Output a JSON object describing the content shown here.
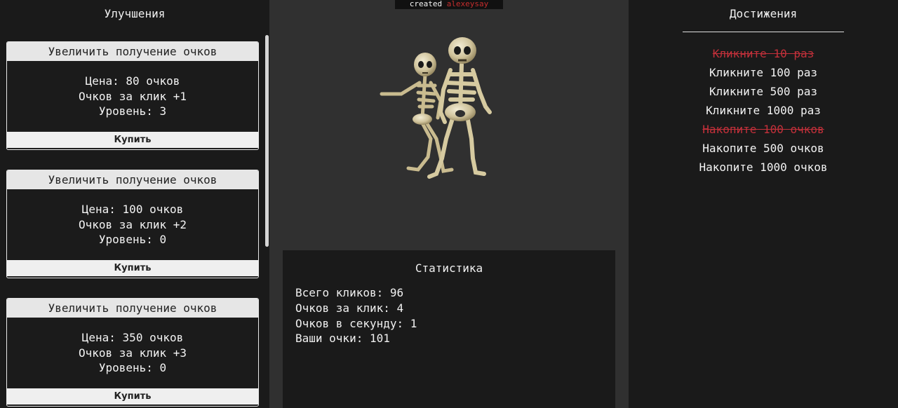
{
  "left": {
    "title": "Улучшения",
    "upgrades": [
      {
        "title": "Увеличить получение очков",
        "price": "Цена: 80 очков",
        "per_click": "Очков за клик +1",
        "level": "Уровень: 3",
        "buy": "Купить"
      },
      {
        "title": "Увеличить получение очков",
        "price": "Цена: 100 очков",
        "per_click": "Очков за клик +2",
        "level": "Уровень: 0",
        "buy": "Купить"
      },
      {
        "title": "Увеличить получение очков",
        "price": "Цена: 350 очков",
        "per_click": "Очков за клик +3",
        "level": "Уровень: 0",
        "buy": "Купить"
      }
    ]
  },
  "credit": {
    "prefix": "created",
    "author": "alexeysay"
  },
  "stats": {
    "title": "Статистика",
    "lines": [
      "Всего кликов: 96",
      "Очков за клик: 4",
      "Очков в секунду: 1",
      "Ваши очки: 101"
    ]
  },
  "achievements": {
    "title": "Достижения",
    "items": [
      {
        "label": "Кликните 10 раз",
        "done": true
      },
      {
        "label": "Кликните 100 раз",
        "done": false
      },
      {
        "label": "Кликните 500 раз",
        "done": false
      },
      {
        "label": "Кликните 1000 раз",
        "done": false
      },
      {
        "label": "Накопите 100 очков",
        "done": true
      },
      {
        "label": "Накопите 500 очков",
        "done": false
      },
      {
        "label": "Накопите 1000 очков",
        "done": false
      }
    ]
  },
  "colors": {
    "done": "#c3303a",
    "author": "#c62d2d"
  },
  "icons": {
    "clicker": "dancing-skeletons-icon"
  }
}
